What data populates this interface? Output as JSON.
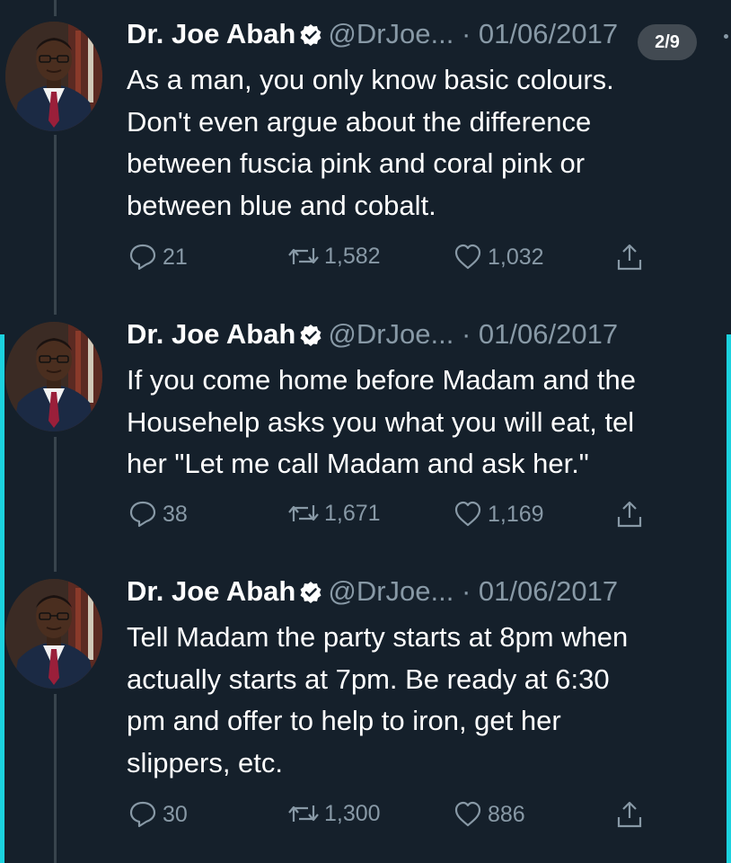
{
  "colors": {
    "background": "#15202b",
    "text": "#ffffff",
    "secondary": "#8899a6",
    "accent": "#1bd2df",
    "thread_line": "#38444d"
  },
  "page_badge": "2/9",
  "tweets": [
    {
      "name": "Dr. Joe Abah",
      "handle": "@DrJoe...",
      "date": "· 01/06/2017",
      "text": "As a man, you only know basic colours.\nDon't even argue about the difference\nbetween fuscia pink and coral pink or\nbetween blue and cobalt.",
      "replies": "21",
      "retweets": "1,582",
      "likes": "1,032"
    },
    {
      "name": "Dr. Joe Abah",
      "handle": "@DrJoe...",
      "date": "· 01/06/2017",
      "text": "If you come home before Madam and the\nHousehelp asks you what you will eat, tel\nher \"Let me call Madam and ask her.\"",
      "replies": "38",
      "retweets": "1,671",
      "likes": "1,169"
    },
    {
      "name": "Dr. Joe Abah",
      "handle": "@DrJoe...",
      "date": "· 01/06/2017",
      "text": "Tell Madam the party starts at 8pm when\nactually starts at 7pm. Be ready at 6:30\npm and offer to help to iron, get her\nslippers, etc.",
      "replies": "30",
      "retweets": "1,300",
      "likes": "886"
    }
  ]
}
